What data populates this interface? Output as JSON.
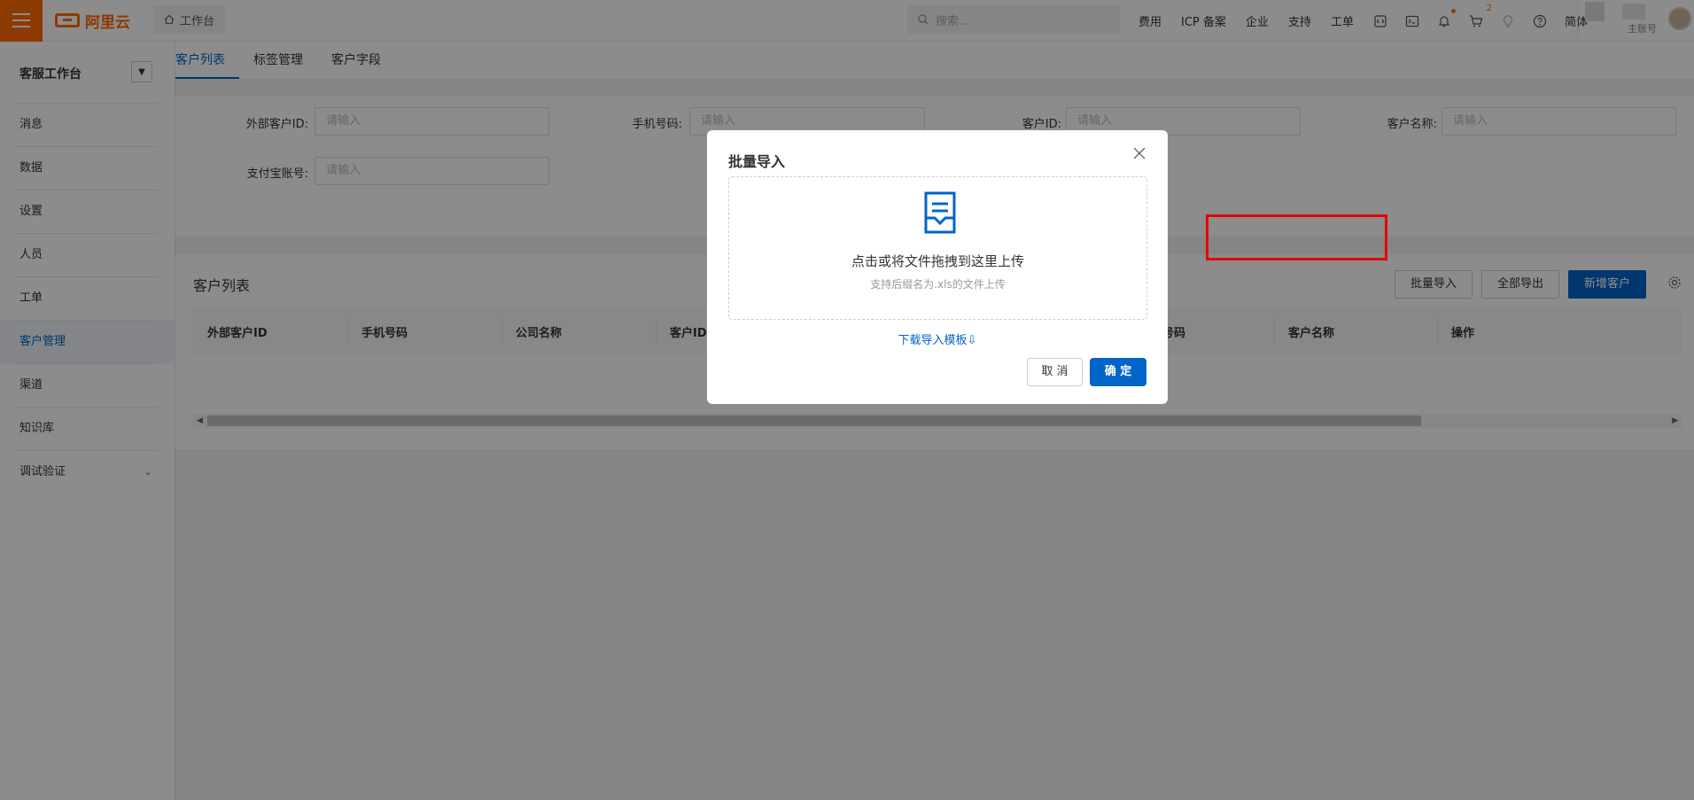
{
  "topbar": {
    "brand": "阿里云",
    "workbench": "工作台",
    "search_placeholder": "搜索...",
    "links": [
      "费用",
      "ICP 备案",
      "企业",
      "支持",
      "工单"
    ],
    "cart_count": "2",
    "lang": "简体",
    "account_sub": "主账号"
  },
  "sidebar": {
    "title": "客服工作台",
    "items": [
      {
        "label": "消息"
      },
      {
        "label": "数据"
      },
      {
        "label": "设置"
      },
      {
        "label": "人员"
      },
      {
        "label": "工单"
      },
      {
        "label": "客户管理",
        "active": true
      },
      {
        "label": "渠道"
      },
      {
        "label": "知识库"
      },
      {
        "label": "调试验证"
      }
    ]
  },
  "tabs": [
    "客户列表",
    "标签管理",
    "客户字段"
  ],
  "filter": {
    "fields": [
      {
        "label": "外部客户ID:",
        "placeholder": "请输入"
      },
      {
        "label": "手机号码:",
        "placeholder": "请输入"
      },
      {
        "label": "客户ID:",
        "placeholder": "请输入"
      },
      {
        "label": "客户名称:",
        "placeholder": "请输入"
      },
      {
        "label": "支付宝账号:",
        "placeholder": "请输入"
      }
    ]
  },
  "list": {
    "title": "客户列表",
    "buttons": {
      "batch_import": "批量导入",
      "export_all": "全部导出",
      "add_customer": "新增客户"
    },
    "columns": [
      "外部客户ID",
      "手机号码",
      "公司名称",
      "客户ID",
      "号码",
      "客户名称",
      "操作"
    ]
  },
  "dialog": {
    "title": "批量导入",
    "upload_main": "点击或将文件拖拽到这里上传",
    "upload_sub": "支持后缀名为.xls的文件上传",
    "download_link": "下载导入模板⇩",
    "cancel": "取 消",
    "ok": "确 定"
  },
  "colors": {
    "brand": "#ff6a00",
    "primary": "#0064c8",
    "highlight": "#e60000"
  }
}
